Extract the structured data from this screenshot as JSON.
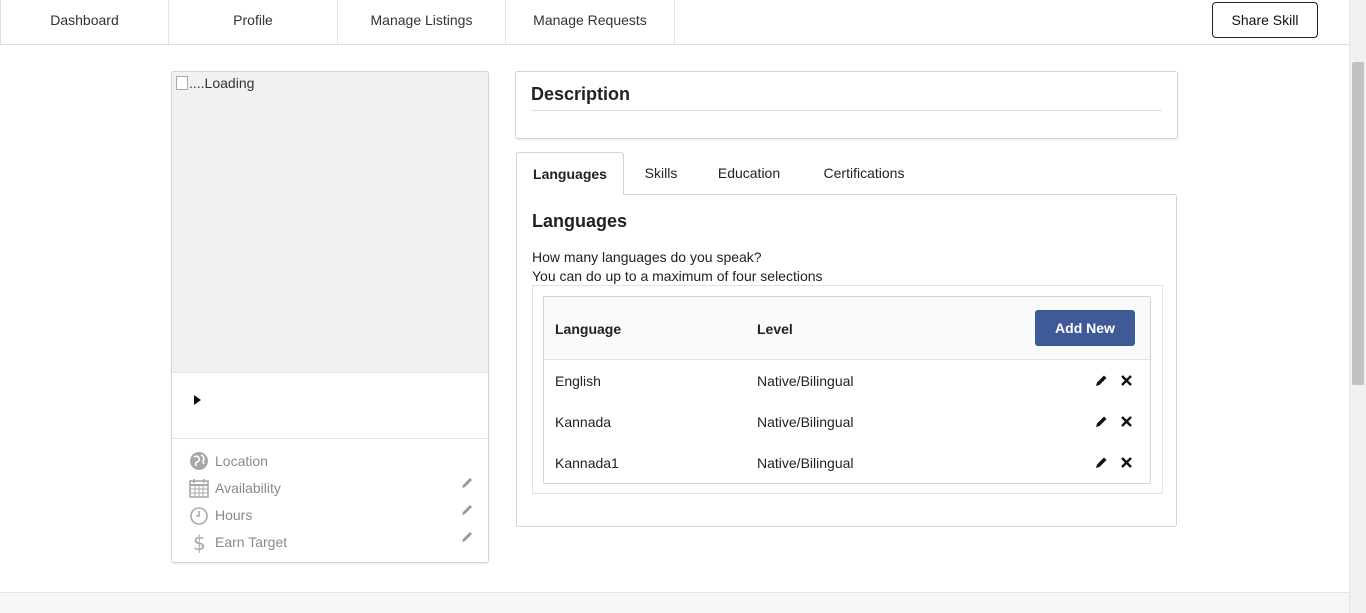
{
  "nav": {
    "items": [
      {
        "label": "Dashboard"
      },
      {
        "label": "Profile"
      },
      {
        "label": "Manage Listings"
      },
      {
        "label": "Manage Requests"
      }
    ],
    "share_label": "Share Skill"
  },
  "profile_card": {
    "photo_alt": "....Loading",
    "details": [
      {
        "label": "Location",
        "icon": "globe-icon",
        "editable": false
      },
      {
        "label": "Availability",
        "icon": "calendar-icon",
        "editable": true
      },
      {
        "label": "Hours",
        "icon": "clock-icon",
        "editable": true
      },
      {
        "label": "Earn Target",
        "icon": "dollar-icon",
        "editable": true
      }
    ]
  },
  "description": {
    "title": "Description"
  },
  "tabs": [
    {
      "label": "Languages",
      "active": true
    },
    {
      "label": "Skills",
      "active": false
    },
    {
      "label": "Education",
      "active": false
    },
    {
      "label": "Certifications",
      "active": false
    }
  ],
  "languages_panel": {
    "title": "Languages",
    "question": "How many languages do you speak?",
    "hint": "You can do up to a maximum of four selections",
    "columns": [
      "Language",
      "Level"
    ],
    "add_label": "Add New",
    "rows": [
      {
        "language": "English",
        "level": "Native/Bilingual"
      },
      {
        "language": "Kannada",
        "level": "Native/Bilingual"
      },
      {
        "language": "Kannada1",
        "level": "Native/Bilingual"
      }
    ]
  },
  "colors": {
    "primary_button": "#3f5a96",
    "muted_text": "#8a8a8a",
    "border": "#d4d4d5"
  }
}
